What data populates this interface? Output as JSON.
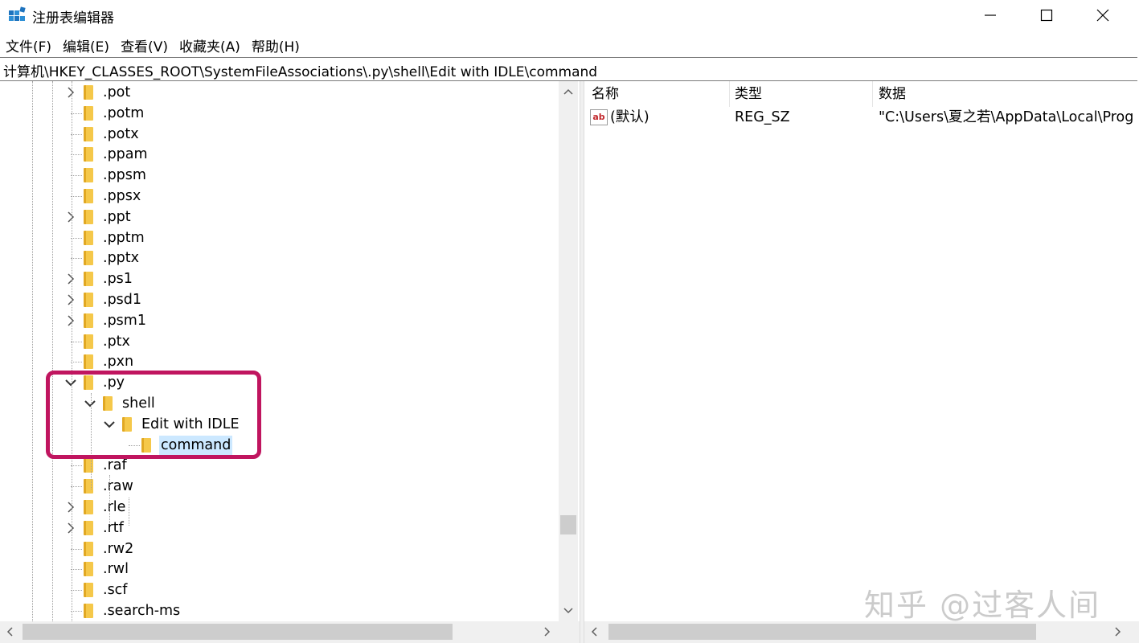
{
  "window": {
    "title": "注册表编辑器"
  },
  "menu": [
    "文件(F)",
    "编辑(E)",
    "查看(V)",
    "收藏夹(A)",
    "帮助(H)"
  ],
  "address": "计算机\\HKEY_CLASSES_ROOT\\SystemFileAssociations\\.py\\shell\\Edit with IDLE\\command",
  "tree": [
    {
      "label": ".pot",
      "expandable": true
    },
    {
      "label": ".potm",
      "expandable": false
    },
    {
      "label": ".potx",
      "expandable": false
    },
    {
      "label": ".ppam",
      "expandable": false
    },
    {
      "label": ".ppsm",
      "expandable": false
    },
    {
      "label": ".ppsx",
      "expandable": false
    },
    {
      "label": ".ppt",
      "expandable": true
    },
    {
      "label": ".pptm",
      "expandable": false
    },
    {
      "label": ".pptx",
      "expandable": false
    },
    {
      "label": ".ps1",
      "expandable": true
    },
    {
      "label": ".psd1",
      "expandable": true
    },
    {
      "label": ".psm1",
      "expandable": true
    },
    {
      "label": ".ptx",
      "expandable": false
    },
    {
      "label": ".pxn",
      "expandable": false
    },
    {
      "label": ".py",
      "expandable": true,
      "expanded": true
    },
    {
      "label": "shell",
      "expandable": true,
      "expanded": true
    },
    {
      "label": "Edit with IDLE",
      "expandable": true,
      "expanded": true
    },
    {
      "label": "command",
      "expandable": false,
      "selected": true
    },
    {
      "label": ".raf",
      "expandable": false
    },
    {
      "label": ".raw",
      "expandable": false
    },
    {
      "label": ".rle",
      "expandable": true
    },
    {
      "label": ".rtf",
      "expandable": true
    },
    {
      "label": ".rw2",
      "expandable": false
    },
    {
      "label": ".rwl",
      "expandable": false
    },
    {
      "label": ".scf",
      "expandable": false
    },
    {
      "label": ".search-ms",
      "expandable": false
    }
  ],
  "list": {
    "columns": [
      "名称",
      "类型",
      "数据"
    ],
    "rows": [
      {
        "name": "(默认)",
        "type": "REG_SZ",
        "data": "\"C:\\Users\\夏之若\\AppData\\Local\\Prog",
        "icon": "ab"
      }
    ]
  },
  "watermark": "知乎 @过客人间",
  "colors": {
    "highlight": "#c0155f",
    "selection": "#cce8ff",
    "folder": "#f5c84a"
  }
}
